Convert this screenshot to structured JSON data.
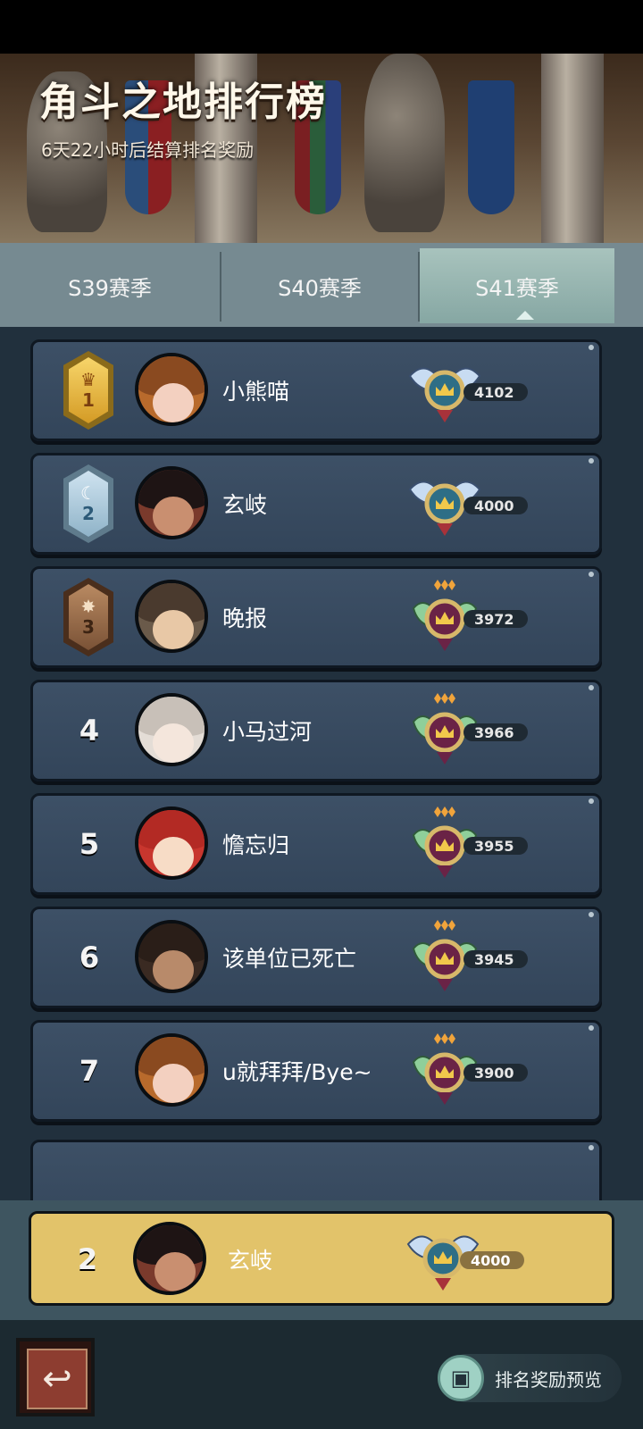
{
  "header": {
    "title": "角斗之地排行榜",
    "subtitle": "6天22小时后结算排名奖励"
  },
  "tabs": [
    {
      "label": "S39赛季",
      "active": false
    },
    {
      "label": "S40赛季",
      "active": false
    },
    {
      "label": "S41赛季",
      "active": true
    }
  ],
  "rows": [
    {
      "rank": "1",
      "rank_style": "gold-medal",
      "name": "小熊喵",
      "score": "4102",
      "badge": "winged-crown-badge",
      "avatar": "pumpkin-hood"
    },
    {
      "rank": "2",
      "rank_style": "silver-medal",
      "name": "玄岐",
      "score": "4000",
      "badge": "winged-crown-badge",
      "avatar": "dark-hair"
    },
    {
      "rank": "3",
      "rank_style": "bronze-medal",
      "name": "晚报",
      "score": "3972",
      "badge": "leaf-crown-badge",
      "avatar": "lion-mane"
    },
    {
      "rank": "4",
      "rank_style": "number",
      "name": "小马过河",
      "score": "3966",
      "badge": "leaf-crown-badge",
      "avatar": "mustache"
    },
    {
      "rank": "5",
      "rank_style": "number",
      "name": "憺忘归",
      "score": "3955",
      "badge": "leaf-crown-badge",
      "avatar": "strawberry-hat"
    },
    {
      "rank": "6",
      "rank_style": "number",
      "name": "该单位已死亡",
      "score": "3945",
      "badge": "leaf-crown-badge",
      "avatar": "cowboy-hat"
    },
    {
      "rank": "7",
      "rank_style": "number",
      "name": "u就拜拜/Bye~",
      "score": "3900",
      "badge": "leaf-crown-badge",
      "avatar": "pumpkin-hood"
    }
  ],
  "my_rank": {
    "rank": "2",
    "name": "玄岐",
    "score": "4000",
    "badge": "winged-crown-badge"
  },
  "footer": {
    "preview_label": "排名奖励预览"
  },
  "colors": {
    "gold": "#e2c36a",
    "row_bg": "#3a4d62",
    "tab_active": "#9bb8b2"
  }
}
